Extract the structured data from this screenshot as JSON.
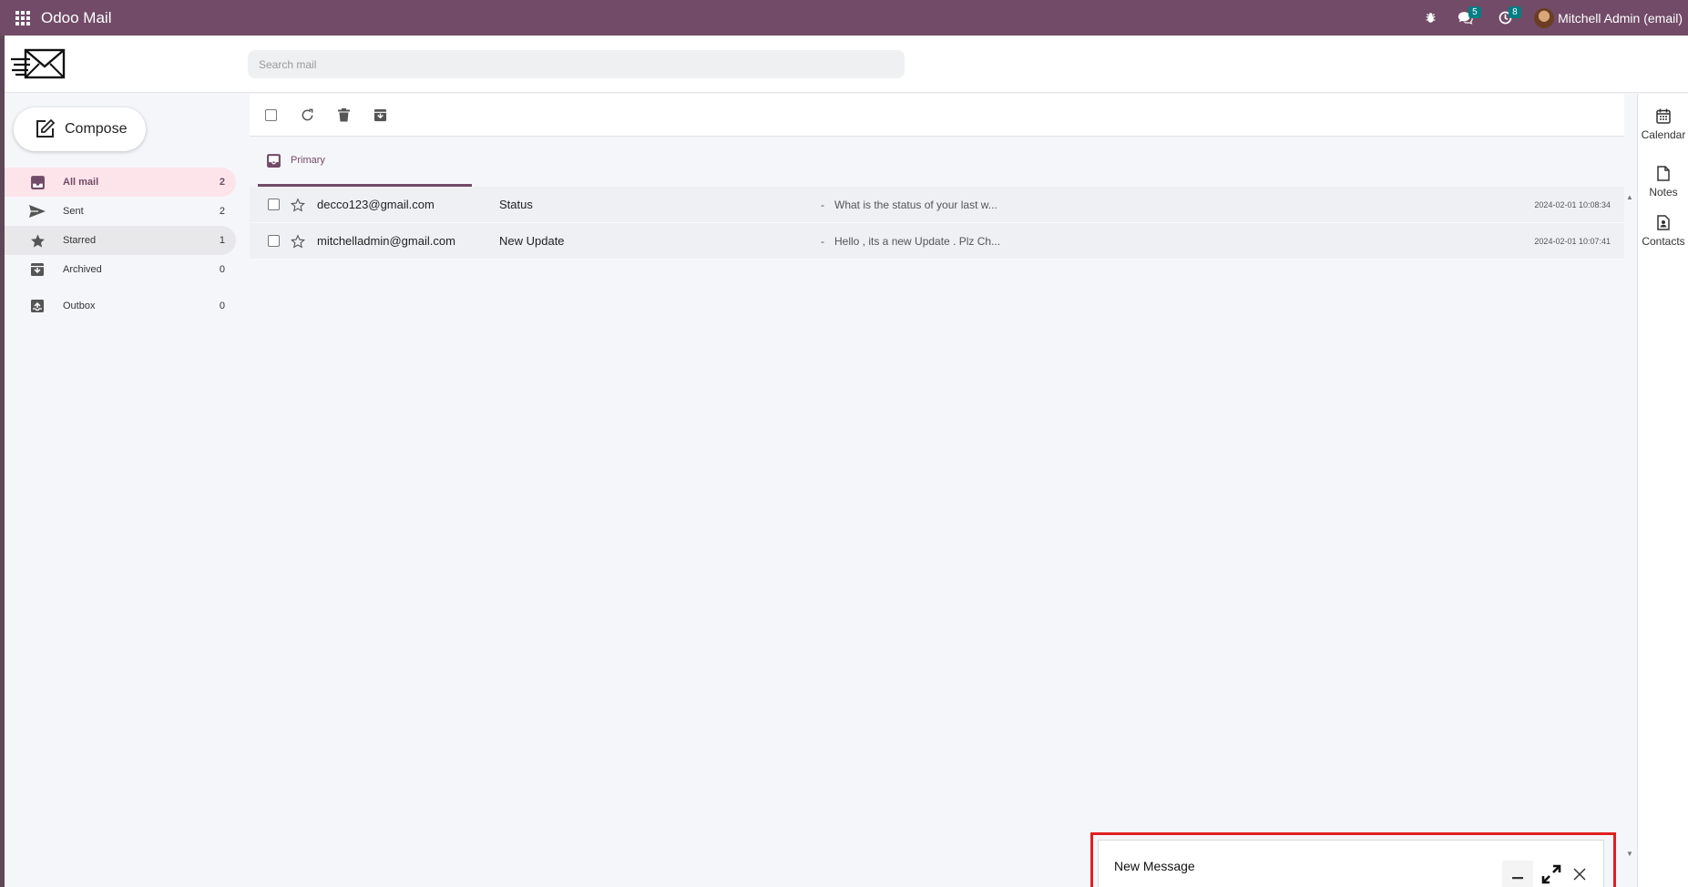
{
  "app": {
    "title": "Odoo Mail"
  },
  "topbar": {
    "icons": [
      "apps-grid-icon",
      "debug-bug-icon",
      "chat-bubbles-icon",
      "clock-activity-icon"
    ],
    "messages_count": "5",
    "activities_count": "8",
    "user_name": "Mitchell Admin (email)"
  },
  "header": {
    "logo": "mail-envelope-logo",
    "search_placeholder": "Search mail"
  },
  "sidebar": {
    "compose_label": "Compose",
    "items": [
      {
        "label": "All mail",
        "count": "2",
        "icon": "inbox-icon",
        "active": true
      },
      {
        "label": "Sent",
        "count": "2",
        "icon": "send-icon"
      },
      {
        "label": "Starred",
        "count": "1",
        "icon": "star-icon"
      },
      {
        "label": "Archived",
        "count": "0",
        "icon": "archive-icon"
      },
      {
        "label": "Outbox",
        "count": "0",
        "icon": "outbox-icon"
      }
    ]
  },
  "toolbar": {
    "icons": [
      "select-all-checkbox",
      "refresh-icon",
      "trash-icon",
      "archive-icon"
    ]
  },
  "tabs": {
    "primary_label": "Primary"
  },
  "mails": [
    {
      "from": "decco123@gmail.com",
      "subject": "Status",
      "dash": "-",
      "snippet": "What is the status of your last w...",
      "date": "2024-02-01 10:08:34"
    },
    {
      "from": "mitchelladmin@gmail.com",
      "subject": "New Update",
      "dash": "-",
      "snippet": "Hello , its a new Update . Plz Ch...",
      "date": "2024-02-01 10:07:41"
    }
  ],
  "rail": {
    "items": [
      {
        "label": "Calendar",
        "icon": "calendar-icon"
      },
      {
        "label": "Notes",
        "icon": "note-icon"
      },
      {
        "label": "Contacts",
        "icon": "contact-card-icon"
      }
    ]
  },
  "new_message": {
    "title": "New Message",
    "icons": [
      "minimize-icon",
      "expand-icon",
      "close-icon"
    ]
  },
  "colors": {
    "brand": "#714b67",
    "active_bg": "#fde4ea",
    "badge": "#017e84",
    "highlight": "#e02020"
  }
}
